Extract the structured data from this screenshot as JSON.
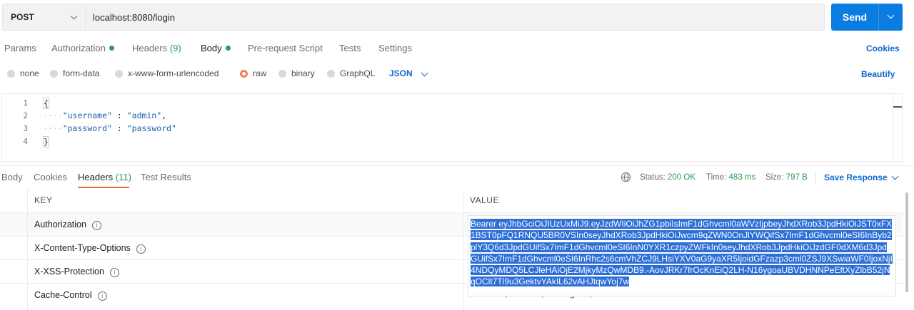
{
  "request": {
    "method": "POST",
    "url": "localhost:8080/login",
    "send_label": "Send"
  },
  "request_tabs": [
    {
      "label": "Params"
    },
    {
      "label": "Authorization",
      "dot": true
    },
    {
      "label": "Headers",
      "count": "(9)"
    },
    {
      "label": "Body",
      "dot": true,
      "active": true
    },
    {
      "label": "Pre-request Script"
    },
    {
      "label": "Tests"
    },
    {
      "label": "Settings"
    }
  ],
  "cookies_label": "Cookies",
  "body_types": [
    "none",
    "form-data",
    "x-www-form-urlencoded",
    "raw",
    "binary",
    "GraphQL"
  ],
  "body_type_selected": "raw",
  "format_label": "JSON",
  "beautify_label": "Beautify",
  "editor": {
    "line_numbers": [
      "1",
      "2",
      "3",
      "4"
    ],
    "open_brace": "{",
    "close_brace": "}",
    "lines": [
      {
        "key": "\"username\"",
        "sep": " : ",
        "value": "\"admin\"",
        "trail": ","
      },
      {
        "key": "\"password\"",
        "sep": " : ",
        "value": "\"password\"",
        "trail": ""
      }
    ]
  },
  "response_tabs": [
    {
      "label": "Body"
    },
    {
      "label": "Cookies"
    },
    {
      "label": "Headers",
      "count": "(11)",
      "active": true
    },
    {
      "label": "Test Results"
    }
  ],
  "status": {
    "status_label": "Status:",
    "status_value": "200 OK",
    "time_label": "Time:",
    "time_value": "483 ms",
    "size_label": "Size:",
    "size_value": "797 B",
    "save_label": "Save Response"
  },
  "headers_table": {
    "key_header": "KEY",
    "value_header": "VALUE",
    "rows": [
      {
        "key": "Authorization"
      },
      {
        "key": "X-Content-Type-Options"
      },
      {
        "key": "X-XSS-Protection"
      },
      {
        "key": "Cache-Control",
        "value": "no-cache, no-store, max-age=0, must-revalidate"
      }
    ],
    "authorization_value": "Bearer eyJhbGciOiJIUzUxMiJ9.eyJzdWIiOiJhZG1pbiIsImF1dGhvcml0aWVzIjpbeyJhdXRob3JpdHkiOiJST0xFX1BST0pFQ1RNQU5BR0VSIn0seyJhdXRob3JpdHkiOiJwcm9qZWN0OnJlYWQifSx7ImF1dGhvcml0eSI6InByb2plY3Q6d3JpdGUifSx7ImF1dGhvcml0eSI6InN0YXR1czpyZWFkIn0seyJhdXRob3JpdHkiOiJzdGF0dXM6d3JpdGUifSx7ImF1dGhvcml0eSI6InRhc2s6cmVhZCJ9LHsiYXV0aG9yaXR5IjoidGFzazp3cml0ZSJ9XSwiaWF0IjoxNjI4NDQyMDQ5LCJleHAiOjE2MjkyMzQwMDB9.-AovJRKr7frOcKnEiQ2LH-N16ygoaUBVDHNNPeEftXyZlbB52jNqOClt7Tl9u3GektvYAkIL62vAHJtqwYoj7w"
  },
  "colors": {
    "send": "#0b7ce0",
    "accent_tab": "#f26b3a",
    "status_green": "#2d9a4f",
    "link_blue": "#0b6bcb",
    "selection": "#2e6fd6"
  }
}
